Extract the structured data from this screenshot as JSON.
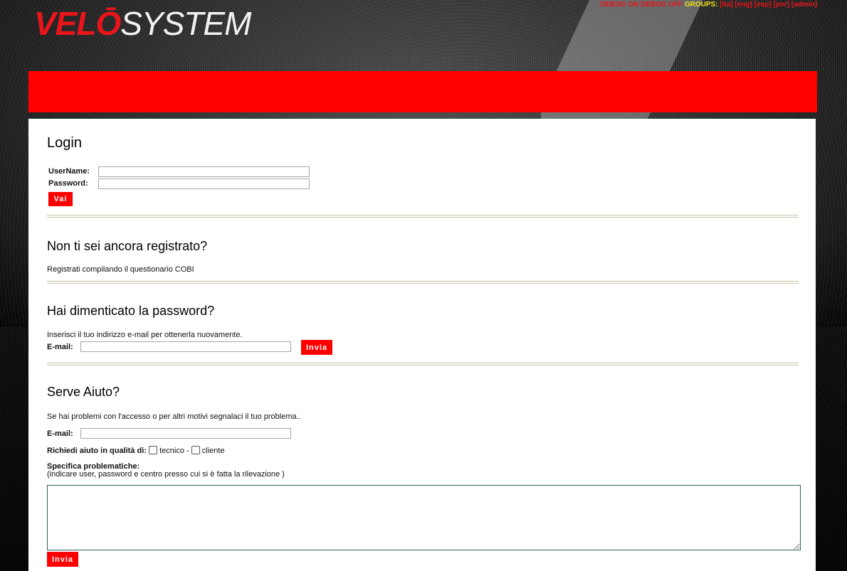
{
  "header": {
    "logo_part1": "VELŌ",
    "logo_part2": "SYSTEM",
    "debug_on": "DEBUG ON",
    "debug_off": "DEBUG OFF",
    "groups_label": "GROUPS:",
    "languages": [
      "[ita]",
      "[eng]",
      "[esp]",
      "[por]",
      "[admin]"
    ]
  },
  "login": {
    "title": "Login",
    "username_label": "UserName:",
    "username_value": "",
    "password_label": "Password:",
    "password_value": "",
    "submit_label": "Vai"
  },
  "register": {
    "title": "Non ti sei ancora registrato?",
    "text": "Registrati compilando il questionario COBI"
  },
  "forgot": {
    "title": "Hai dimenticato la password?",
    "text": "Inserisci il tuo indirizzo e-mail per ottenerla nuovamente.",
    "email_label": "E-mail:",
    "email_value": "",
    "submit_label": "Invia"
  },
  "help": {
    "title": "Serve Aiuto?",
    "text": "Se hai problemi con l'accesso o per altri motivi segnalaci il tuo problema..",
    "email_label": "E-mail:",
    "email_value": "",
    "role_label": "Richiedi aiuto in qualità di:",
    "role_option1": "tecnico",
    "role_separator": "-",
    "role_option2": "cliente",
    "details_label": "Specifica problematiche:",
    "details_hint": "(indicare user, password e centro presso cui si è fatta la rilevazione )",
    "details_value": "",
    "submit_label": "Invia"
  },
  "colors": {
    "brand_red": "#ff0000",
    "groups_yellow": "#f2e31a"
  }
}
